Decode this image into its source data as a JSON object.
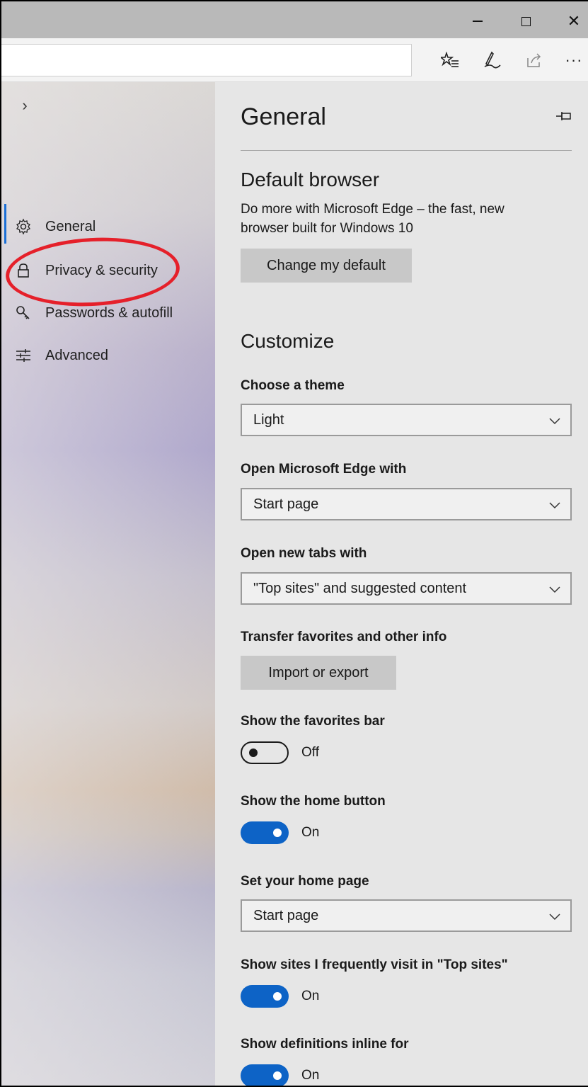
{
  "titlebar": {
    "minimize_icon": "minimize-icon",
    "maximize_icon": "maximize-icon",
    "close_glyph": "✕"
  },
  "toolbar": {
    "address_value": "",
    "more_glyph": "···"
  },
  "sidebar": {
    "collapse_glyph": "›",
    "items": [
      {
        "label": "General",
        "icon": "gear-icon"
      },
      {
        "label": "Privacy & security",
        "icon": "lock-icon"
      },
      {
        "label": "Passwords & autofill",
        "icon": "key-icon"
      },
      {
        "label": "Advanced",
        "icon": "sliders-icon"
      }
    ],
    "highlight_color": "#e5202a",
    "accent_color": "#1a6fd6"
  },
  "settings": {
    "title": "General",
    "default_browser": {
      "heading": "Default browser",
      "description": "Do more with Microsoft Edge – the fast, new browser built for Windows 10",
      "button_label": "Change my default"
    },
    "customize": {
      "heading": "Customize",
      "theme_label": "Choose a theme",
      "theme_value": "Light",
      "open_with_label": "Open Microsoft Edge with",
      "open_with_value": "Start page",
      "new_tabs_label": "Open new tabs with",
      "new_tabs_value": "\"Top sites\" and suggested content",
      "transfer_label": "Transfer favorites and other info",
      "transfer_button": "Import or export",
      "favorites_bar_label": "Show the favorites bar",
      "favorites_bar_state": "Off",
      "home_button_label": "Show the home button",
      "home_button_state": "On",
      "home_page_label": "Set your home page",
      "home_page_value": "Start page",
      "top_sites_label": "Show sites I frequently visit in \"Top sites\"",
      "top_sites_state": "On",
      "definitions_label": "Show definitions inline for",
      "definitions_state": "On"
    },
    "toggle_on_color": "#0d63c6"
  }
}
